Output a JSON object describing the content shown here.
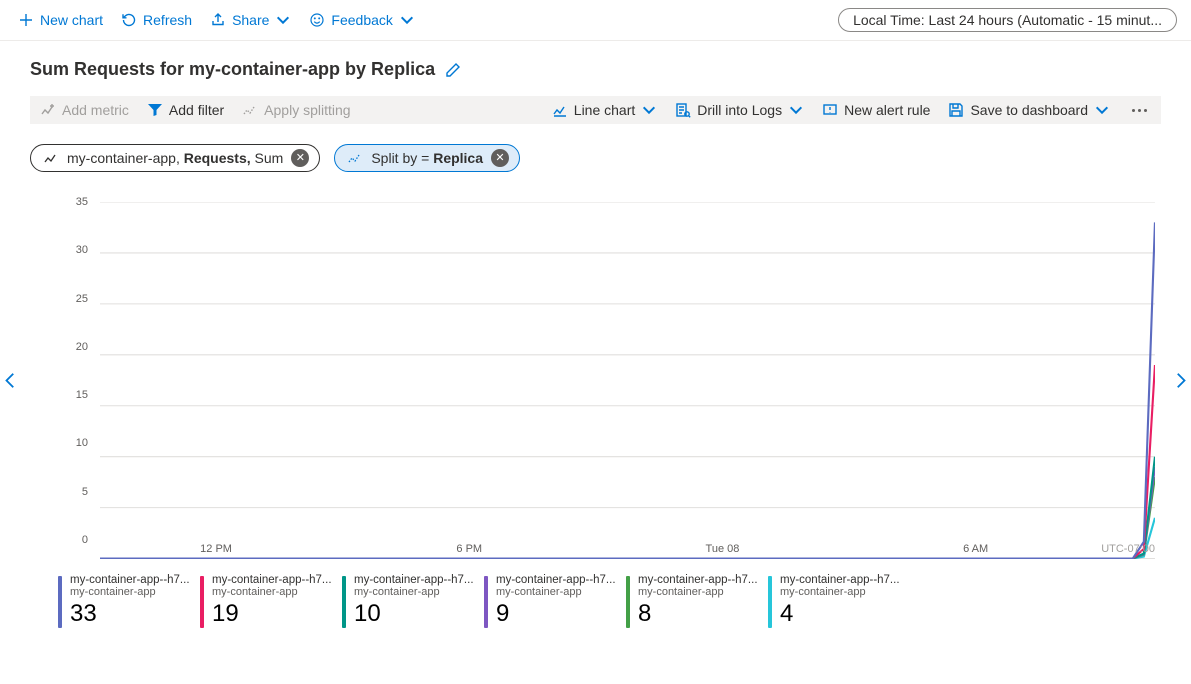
{
  "topbar": {
    "new_chart": "New chart",
    "refresh": "Refresh",
    "share": "Share",
    "feedback": "Feedback",
    "timerange": "Local Time: Last 24 hours (Automatic - 15 minut..."
  },
  "title": "Sum Requests for my-container-app by Replica",
  "toolbar2": {
    "add_metric": "Add metric",
    "add_filter": "Add filter",
    "apply_splitting": "Apply splitting",
    "chart_type": "Line chart",
    "drill_logs": "Drill into Logs",
    "new_alert": "New alert rule",
    "save_dashboard": "Save to dashboard"
  },
  "pill_metric": {
    "resource": "my-container-app, ",
    "metric": "Requests, ",
    "agg": "Sum"
  },
  "pill_split": {
    "prefix": "Split by = ",
    "value": "Replica"
  },
  "timezone": "UTC-07:00",
  "chart_data": {
    "type": "line",
    "xlabel": "",
    "ylabel": "",
    "ylim": [
      0,
      35
    ],
    "y_ticks": [
      0,
      5,
      10,
      15,
      20,
      25,
      30,
      35
    ],
    "x_tick_labels": [
      "12 PM",
      "6 PM",
      "Tue 08",
      "6 AM"
    ],
    "x_tick_positions_pct": [
      11,
      35,
      59,
      83
    ],
    "n_points": 96,
    "series": [
      {
        "name": "my-container-app--h7...",
        "subtitle": "my-container-app",
        "color": "#5c6bc0",
        "value_label": 33,
        "final": 33
      },
      {
        "name": "my-container-app--h7...",
        "subtitle": "my-container-app",
        "color": "#e91e63",
        "value_label": 19,
        "final": 19
      },
      {
        "name": "my-container-app--h7...",
        "subtitle": "my-container-app",
        "color": "#009688",
        "value_label": 10,
        "final": 10
      },
      {
        "name": "my-container-app--h7...",
        "subtitle": "my-container-app",
        "color": "#7e57c2",
        "value_label": 9,
        "final": 9
      },
      {
        "name": "my-container-app--h7...",
        "subtitle": "my-container-app",
        "color": "#43a047",
        "value_label": 8,
        "final": 8
      },
      {
        "name": "my-container-app--h7...",
        "subtitle": "my-container-app",
        "color": "#26c6da",
        "value_label": 4,
        "final": 4
      }
    ]
  }
}
